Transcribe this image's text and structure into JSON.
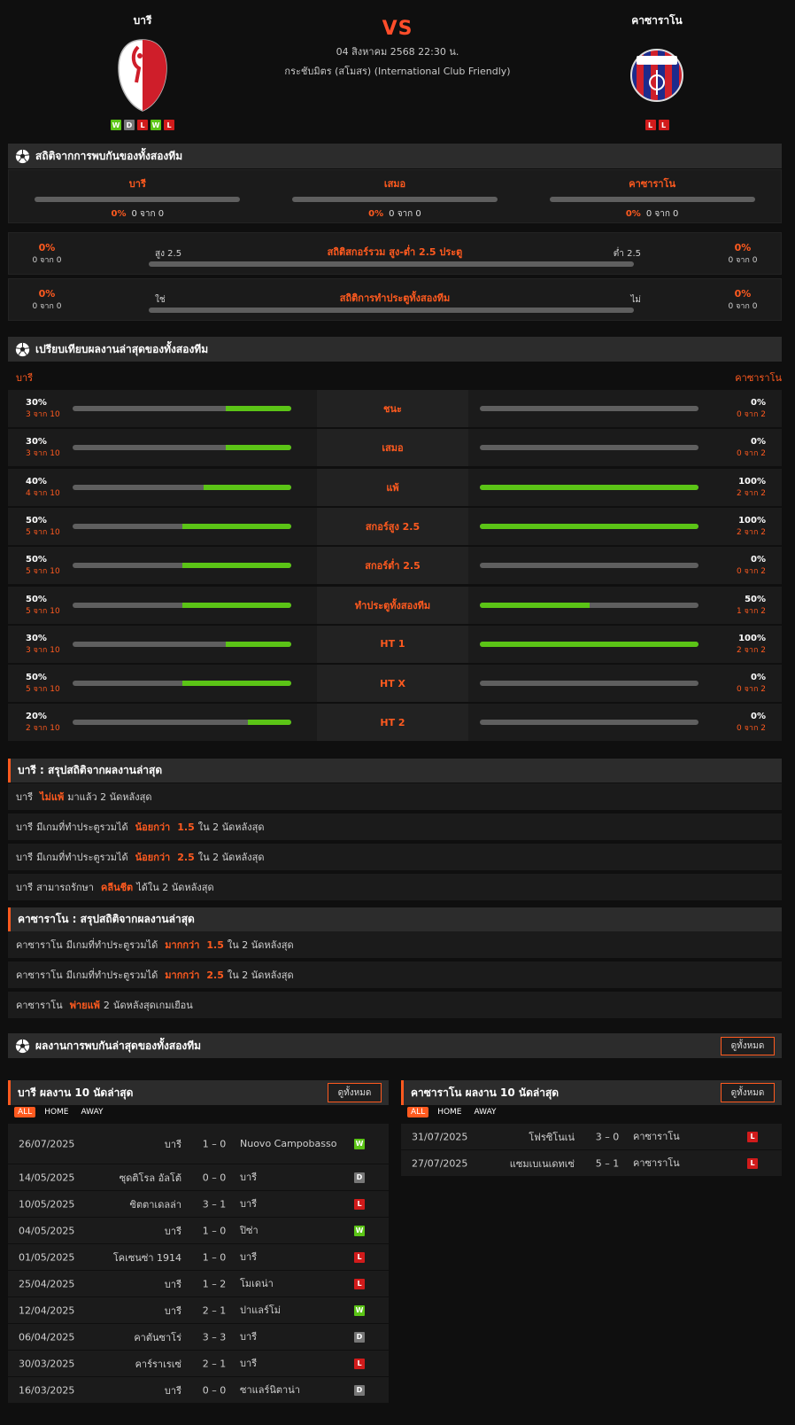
{
  "match": {
    "home": {
      "name": "บารี",
      "form": [
        "W",
        "D",
        "L",
        "W",
        "L"
      ]
    },
    "away": {
      "name": "คาซาราโน",
      "form": [
        "L",
        "L"
      ]
    },
    "vs": "VS",
    "date": "04 สิงหาคม 2568 22:30 น.",
    "competition": "กระชับมิตร (สโมสร) (International Club Friendly)"
  },
  "h2h": {
    "title": "สถิติจากการพบกันของทั้งสองทีม",
    "cols": [
      {
        "label": "บารี",
        "pct": "0%",
        "count": "0 จาก 0"
      },
      {
        "label": "เสมอ",
        "pct": "0%",
        "count": "0 จาก 0"
      },
      {
        "label": "คาซาราโน",
        "pct": "0%",
        "count": "0 จาก 0"
      }
    ],
    "ou": {
      "title": "สถิติสกอร์รวม สูง-ต่ำ 2.5 ประตู",
      "left_label": "สูง 2.5",
      "right_label": "ต่ำ 2.5",
      "left_pct": "0%",
      "left_count": "0 จาก 0",
      "right_pct": "0%",
      "right_count": "0 จาก 0"
    },
    "btts": {
      "title": "สถิติการทำประตูทั้งสองทีม",
      "left_label": "ใช่",
      "right_label": "ไม่",
      "left_pct": "0%",
      "left_count": "0 จาก 0",
      "right_pct": "0%",
      "right_count": "0 จาก 0"
    }
  },
  "compare": {
    "title": "เปรียบเทียบผลงานล่าสุดของทั้งสองทีม",
    "home_name": "บารี",
    "away_name": "คาซาราโน",
    "rows": [
      {
        "label": "ชนะ",
        "home_pct": "30%",
        "home_count": "3 จาก 10",
        "home_val": 0.3,
        "away_pct": "0%",
        "away_count": "0 จาก 2",
        "away_val": 0
      },
      {
        "label": "เสมอ",
        "home_pct": "30%",
        "home_count": "3 จาก 10",
        "home_val": 0.3,
        "away_pct": "0%",
        "away_count": "0 จาก 2",
        "away_val": 0
      },
      {
        "label": "แพ้",
        "home_pct": "40%",
        "home_count": "4 จาก 10",
        "home_val": 0.4,
        "away_pct": "100%",
        "away_count": "2 จาก 2",
        "away_val": 1
      },
      {
        "label": "สกอร์สูง 2.5",
        "home_pct": "50%",
        "home_count": "5 จาก 10",
        "home_val": 0.5,
        "away_pct": "100%",
        "away_count": "2 จาก 2",
        "away_val": 1
      },
      {
        "label": "สกอร์ต่ำ 2.5",
        "home_pct": "50%",
        "home_count": "5 จาก 10",
        "home_val": 0.5,
        "away_pct": "0%",
        "away_count": "0 จาก 2",
        "away_val": 0
      },
      {
        "label": "ทำประตูทั้งสองทีม",
        "home_pct": "50%",
        "home_count": "5 จาก 10",
        "home_val": 0.5,
        "away_pct": "50%",
        "away_count": "1 จาก 2",
        "away_val": 0.5
      },
      {
        "label": "HT 1",
        "home_pct": "30%",
        "home_count": "3 จาก 10",
        "home_val": 0.3,
        "away_pct": "100%",
        "away_count": "2 จาก 2",
        "away_val": 1
      },
      {
        "label": "HT X",
        "home_pct": "50%",
        "home_count": "5 จาก 10",
        "home_val": 0.5,
        "away_pct": "0%",
        "away_count": "0 จาก 2",
        "away_val": 0
      },
      {
        "label": "HT 2",
        "home_pct": "20%",
        "home_count": "2 จาก 10",
        "home_val": 0.2,
        "away_pct": "0%",
        "away_count": "0 จาก 2",
        "away_val": 0
      }
    ]
  },
  "home_summary": {
    "title": "บารี : สรุปสถิติจากผลงานล่าสุด",
    "lines": [
      [
        "บารี",
        "ไม่แพ้",
        "มาแล้ว 2 นัดหลังสุด"
      ],
      [
        "บารี",
        "มีเกมที่ทำประตูรวมได้",
        "น้อยกว่า",
        "1.5",
        "ใน 2 นัดหลังสุด"
      ],
      [
        "บารี",
        "มีเกมที่ทำประตูรวมได้",
        "น้อยกว่า",
        "2.5",
        "ใน 2 นัดหลังสุด"
      ],
      [
        "บารี",
        "สามารถรักษา",
        "คลีนชีต",
        "ได้ใน 2 นัดหลังสุด"
      ]
    ]
  },
  "away_summary": {
    "title": "คาซาราโน : สรุปสถิติจากผลงานล่าสุด",
    "lines": [
      [
        "คาซาราโน",
        "มีเกมที่ทำประตูรวมได้",
        "มากกว่า",
        "1.5",
        "ใน 2 นัดหลังสุด"
      ],
      [
        "คาซาราโน",
        "มีเกมที่ทำประตูรวมได้",
        "มากกว่า",
        "2.5",
        "ใน 2 นัดหลังสุด"
      ],
      [
        "คาซาราโน",
        "พ่ายแพ้",
        "2",
        "นัดหลังสุดเกมเยือน"
      ]
    ]
  },
  "recent_h2h": {
    "title": "ผลงานการพบกันล่าสุดของทั้งสองทีม",
    "view_all": "ดูทั้งหมด"
  },
  "home_list": {
    "title": "บารี ผลงาน 10 นัดล่าสุด",
    "view_all": "ดูทั้งหมด",
    "filters": [
      "ALL",
      "HOME",
      "AWAY"
    ],
    "matches": [
      {
        "date": "26/07/2025",
        "home": "บารี",
        "score": "1 – 0",
        "away": "Nuovo Campobasso",
        "result": "W"
      },
      {
        "date": "14/05/2025",
        "home": "ซุดติโรล อัลโต้",
        "score": "0 – 0",
        "away": "บารี",
        "result": "D"
      },
      {
        "date": "10/05/2025",
        "home": "ซิตตาเดลล่า",
        "score": "3 – 1",
        "away": "บารี",
        "result": "L"
      },
      {
        "date": "04/05/2025",
        "home": "บารี",
        "score": "1 – 0",
        "away": "ปิซ่า",
        "result": "W"
      },
      {
        "date": "01/05/2025",
        "home": "โคเซนซ่า 1914",
        "score": "1 – 0",
        "away": "บารี",
        "result": "L"
      },
      {
        "date": "25/04/2025",
        "home": "บารี",
        "score": "1 – 2",
        "away": "โมเดน่า",
        "result": "L"
      },
      {
        "date": "12/04/2025",
        "home": "บารี",
        "score": "2 – 1",
        "away": "ปาแลร์โม่",
        "result": "W"
      },
      {
        "date": "06/04/2025",
        "home": "คาตันซาโร่",
        "score": "3 – 3",
        "away": "บารี",
        "result": "D"
      },
      {
        "date": "30/03/2025",
        "home": "คาร์ราเรเซ่",
        "score": "2 – 1",
        "away": "บารี",
        "result": "L"
      },
      {
        "date": "16/03/2025",
        "home": "บารี",
        "score": "0 – 0",
        "away": "ซาแลร์นิตาน่า",
        "result": "D"
      }
    ]
  },
  "away_list": {
    "title": "คาซาราโน ผลงาน 10 นัดล่าสุด",
    "view_all": "ดูทั้งหมด",
    "filters": [
      "ALL",
      "HOME",
      "AWAY"
    ],
    "matches": [
      {
        "date": "31/07/2025",
        "home": "โฟรซิโนเน่",
        "score": "3 – 0",
        "away": "คาซาราโน",
        "result": "L"
      },
      {
        "date": "27/07/2025",
        "home": "แซมเบเนเดทเซ่",
        "score": "5 – 1",
        "away": "คาซาราโน",
        "result": "L"
      }
    ]
  },
  "colors": {
    "accent": "#ff5a1f",
    "win": "#5bc416",
    "draw": "#777777",
    "loss": "#d11b1b"
  }
}
